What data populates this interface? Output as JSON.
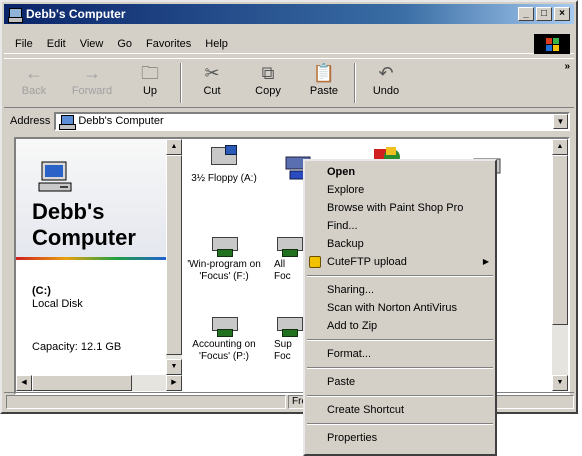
{
  "window": {
    "title": "Debb's Computer",
    "controls": {
      "minimize": "_",
      "maximize": "□",
      "close": "×"
    }
  },
  "menu": [
    "File",
    "Edit",
    "View",
    "Go",
    "Favorites",
    "Help"
  ],
  "toolbar": {
    "back": "Back",
    "forward": "Forward",
    "up": "Up",
    "cut": "Cut",
    "copy": "Copy",
    "paste": "Paste",
    "undo": "Undo",
    "more": "»"
  },
  "address": {
    "label": "Address",
    "value": "Debb's Computer"
  },
  "left_panel": {
    "title_line1": "Debb's",
    "title_line2": "Computer",
    "drive_letter": "(C:)",
    "drive_type": "Local Disk",
    "capacity": "Capacity: 12.1 GB"
  },
  "icons": [
    {
      "label": "3½ Floppy (A:)",
      "kind": "floppy"
    },
    {
      "label": "'Win-program on 'Focus' (F:)",
      "kind": "network"
    },
    {
      "label": "All",
      "kind": "network"
    },
    {
      "label": "Accounting on 'Focus' (P:)",
      "kind": "network"
    },
    {
      "label": "Sup",
      "kind": "network"
    },
    {
      "label": "Foc",
      "kind": "network"
    },
    {
      "label": "Foc",
      "kind": "network"
    }
  ],
  "status": {
    "text": "Fre"
  },
  "context_menu": {
    "items": [
      {
        "label": "Open",
        "bold": true
      },
      {
        "label": "Explore"
      },
      {
        "label": "Browse with Paint Shop Pro"
      },
      {
        "label": "Find..."
      },
      {
        "label": "Backup"
      },
      {
        "label": "CuteFTP upload",
        "submenu": true,
        "icon": "ftp-icon"
      }
    ],
    "group2": [
      {
        "label": "Sharing..."
      },
      {
        "label": "Scan with Norton AntiVirus"
      },
      {
        "label": "Add to Zip"
      }
    ],
    "group3": [
      {
        "label": "Format..."
      }
    ],
    "group4": [
      {
        "label": "Paste"
      }
    ],
    "group5": [
      {
        "label": "Create Shortcut"
      }
    ],
    "group6": [
      {
        "label": "Properties"
      }
    ]
  },
  "colors": {
    "title_bar": "#0a246a",
    "window_face": "#d4d0c8",
    "content_bg": "#ffffff"
  }
}
